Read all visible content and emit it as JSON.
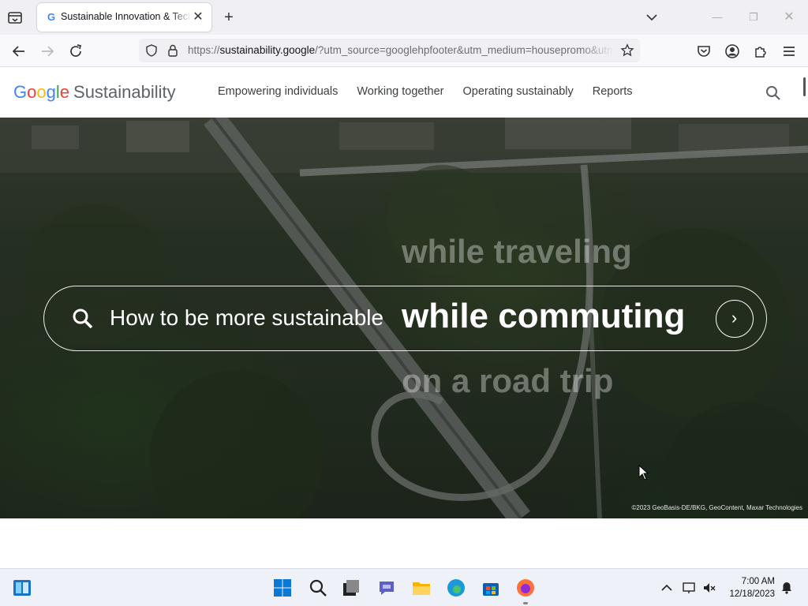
{
  "browser": {
    "tab_title": "Sustainable Innovation & Technology",
    "new_tab": "+",
    "tab_close": "✕",
    "url_prefix": "https://",
    "url_host": "sustainability.google",
    "url_rest": "/?utm_source=googlehpfooter&utm_medium=housepromo&utm_campaign",
    "icons": [
      "tab-list-icon",
      "google-favicon",
      "close-icon",
      "plus-icon",
      "chevron-down-icon",
      "minimize-icon",
      "maximize-icon",
      "close-icon",
      "back-icon",
      "forward-icon",
      "reload-icon",
      "shield-icon",
      "lock-icon",
      "star-icon",
      "pocket-icon",
      "account-icon",
      "extensions-icon",
      "menu-icon"
    ]
  },
  "header": {
    "logo_letters": [
      "G",
      "o",
      "o",
      "g",
      "l",
      "e"
    ],
    "logo_product": "Sustainability",
    "nav": [
      "Empowering individuals",
      "Working together",
      "Operating sustainably",
      "Reports"
    ]
  },
  "hero": {
    "phrase_prev": "while traveling",
    "prefix": "How to be more sustainable",
    "phrase_current": "while commuting",
    "phrase_next": "on a road trip",
    "go_symbol": "›",
    "credit": "©2023 GeoBasis-DE/BKG, GeoContent, Maxar Technologies"
  },
  "taskbar": {
    "time": "7:00 AM",
    "date": "12/18/2023",
    "apps": [
      "widgets-icon",
      "start-icon",
      "search-icon",
      "task-view-icon",
      "chat-icon",
      "file-explorer-icon",
      "edge-icon",
      "store-icon",
      "firefox-icon"
    ]
  },
  "colors": {
    "google_blue": "#4285f4",
    "google_red": "#ea4335",
    "google_yellow": "#fbbc05",
    "google_green": "#34a853",
    "chrome_bg": "#f0f0f4"
  }
}
